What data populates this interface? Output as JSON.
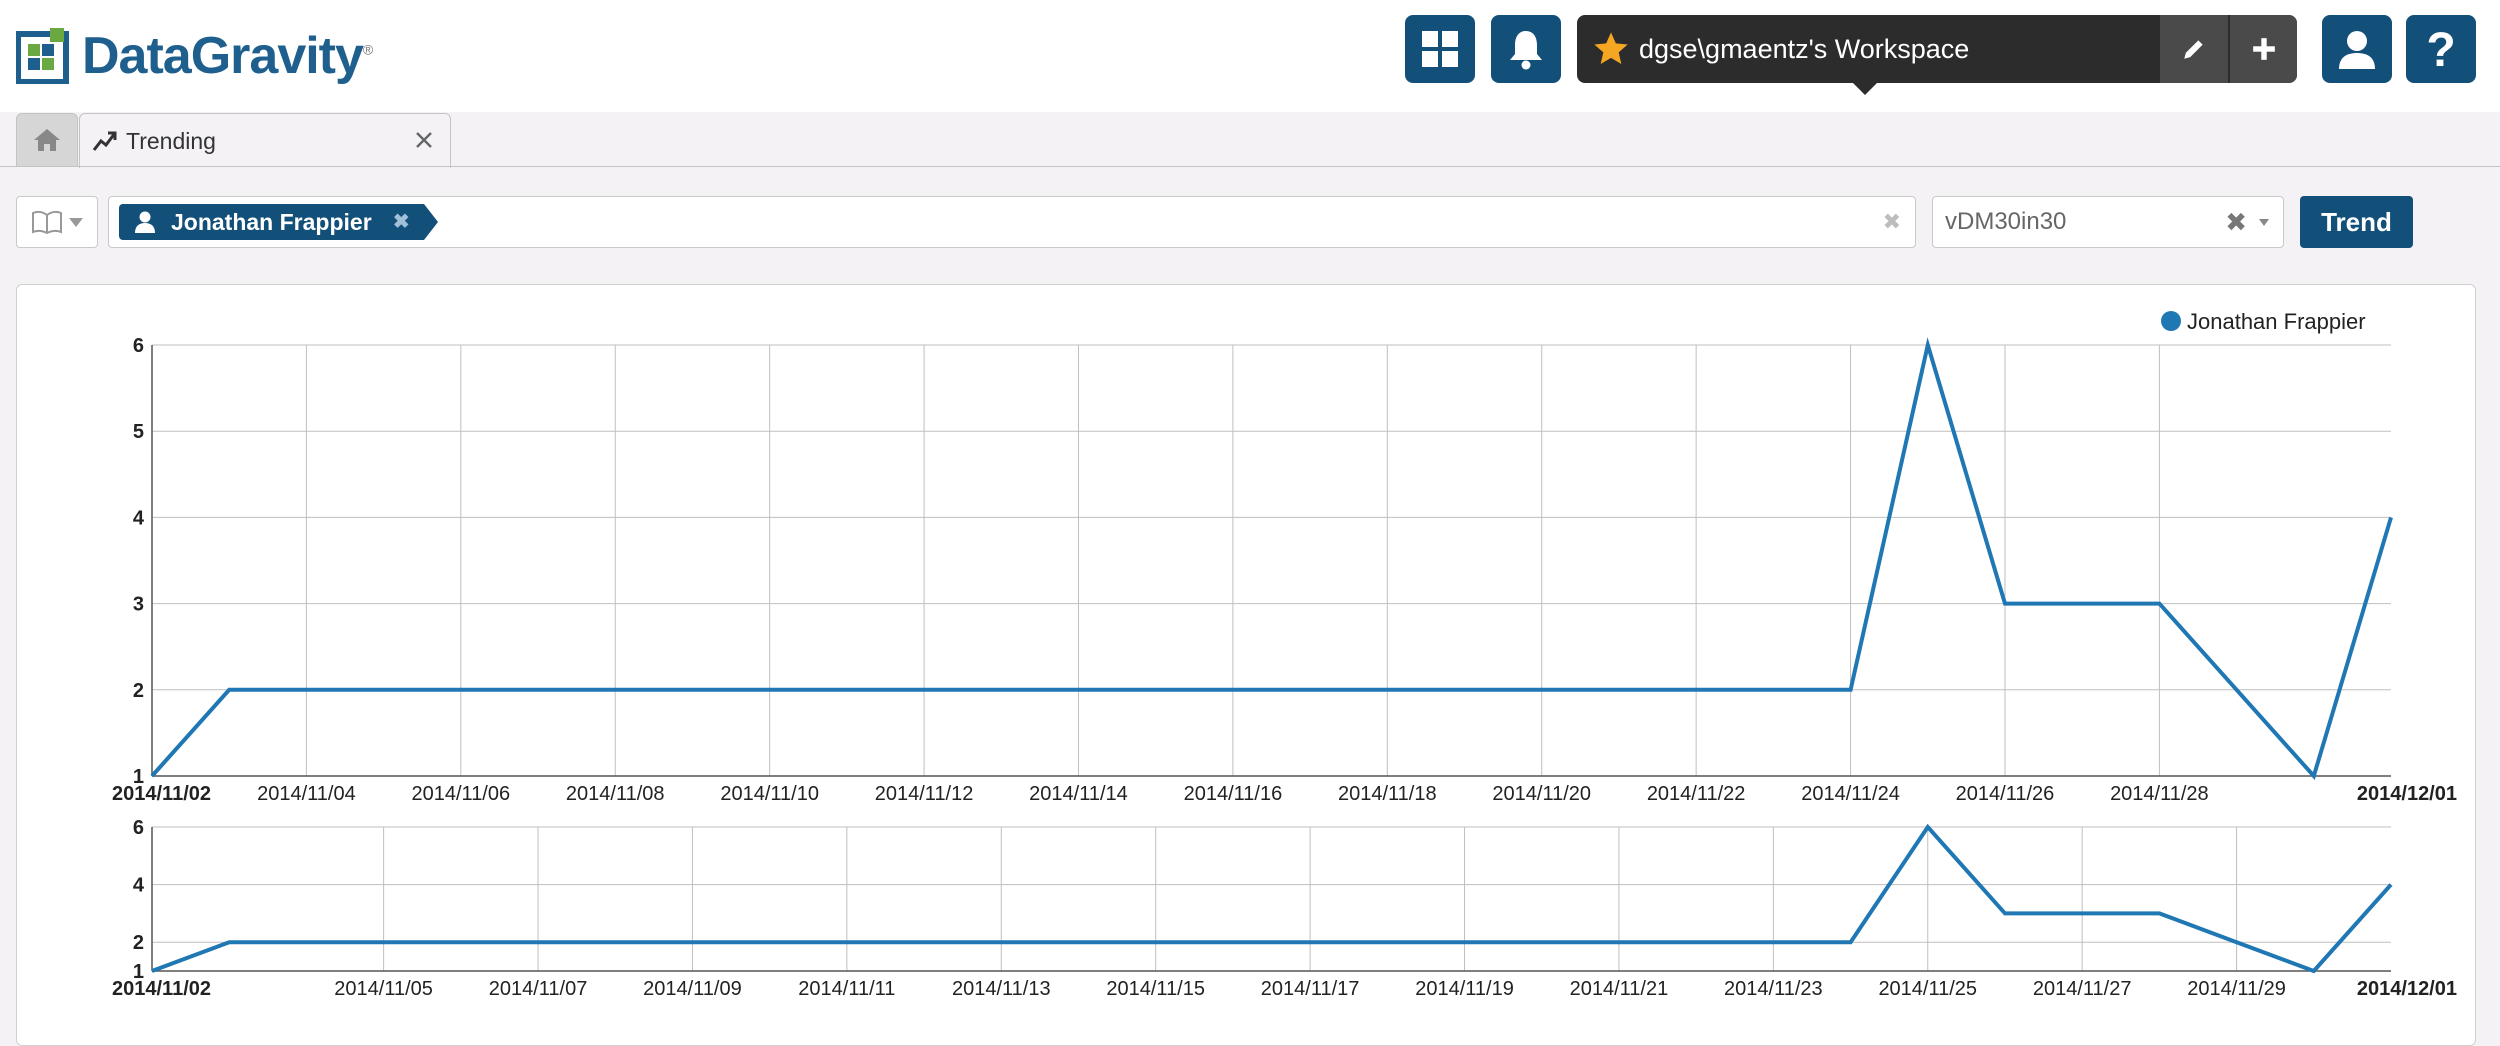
{
  "app": {
    "logo_text": "DataGravity",
    "trademark": "®"
  },
  "header": {
    "workspace_label": "dgse\\gmaentz's Workspace",
    "icons": [
      "dashboard-grid-icon",
      "bell-icon",
      "star-icon",
      "pencil-icon",
      "plus-icon",
      "user-icon",
      "help-icon"
    ]
  },
  "tabs": [
    {
      "id": "home",
      "icon": "home-icon",
      "label": ""
    },
    {
      "id": "trending",
      "icon": "trending-icon",
      "label": "Trending",
      "close": "✕"
    }
  ],
  "filter": {
    "tag_label": "Jonathan Frappier",
    "tag_remove": "✖",
    "search_clear": "✖",
    "select_value": "vDM30in30",
    "select_clear": "✖",
    "trend_button": "Trend"
  },
  "colors": {
    "brand": "#12507a",
    "line": "#1f77b4",
    "logo": "#1f5f8e"
  },
  "chart_data": [
    {
      "type": "line",
      "title": "",
      "xlabel": "",
      "ylabel": "",
      "legend": "top-right",
      "grid": true,
      "ylim": [
        1,
        6
      ],
      "yticks": [
        1,
        2,
        3,
        4,
        5,
        6
      ],
      "xlim": [
        "2014/11/02",
        "2014/12/01"
      ],
      "xticks": [
        "2014/11/02",
        "2014/11/04",
        "2014/11/06",
        "2014/11/08",
        "2014/11/10",
        "2014/11/12",
        "2014/11/14",
        "2014/11/16",
        "2014/11/18",
        "2014/11/20",
        "2014/11/22",
        "2014/11/24",
        "2014/11/26",
        "2014/11/28",
        "2014/12/01"
      ],
      "series": [
        {
          "name": "Jonathan Frappier",
          "x": [
            "2014/11/02",
            "2014/11/03",
            "2014/11/04",
            "2014/11/05",
            "2014/11/06",
            "2014/11/07",
            "2014/11/08",
            "2014/11/09",
            "2014/11/10",
            "2014/11/11",
            "2014/11/12",
            "2014/11/13",
            "2014/11/14",
            "2014/11/15",
            "2014/11/16",
            "2014/11/17",
            "2014/11/18",
            "2014/11/19",
            "2014/11/20",
            "2014/11/21",
            "2014/11/22",
            "2014/11/23",
            "2014/11/24",
            "2014/11/25",
            "2014/11/26",
            "2014/11/27",
            "2014/11/28",
            "2014/11/29",
            "2014/11/30",
            "2014/12/01"
          ],
          "y": [
            1,
            2,
            2,
            2,
            2,
            2,
            2,
            2,
            2,
            2,
            2,
            2,
            2,
            2,
            2,
            2,
            2,
            2,
            2,
            2,
            2,
            2,
            2,
            6,
            3,
            3,
            3,
            2,
            1,
            4
          ]
        }
      ]
    },
    {
      "type": "line",
      "title": "",
      "xlabel": "",
      "ylabel": "",
      "grid": true,
      "ylim": [
        1,
        6
      ],
      "yticks": [
        1,
        2,
        4,
        6
      ],
      "xlim": [
        "2014/11/02",
        "2014/12/01"
      ],
      "xticks": [
        "2014/11/02",
        "2014/11/05",
        "2014/11/07",
        "2014/11/09",
        "2014/11/11",
        "2014/11/13",
        "2014/11/15",
        "2014/11/17",
        "2014/11/19",
        "2014/11/21",
        "2014/11/23",
        "2014/11/25",
        "2014/11/27",
        "2014/11/29",
        "2014/12/01"
      ],
      "series": [
        {
          "name": "Jonathan Frappier",
          "x": [
            "2014/11/02",
            "2014/11/03",
            "2014/11/04",
            "2014/11/05",
            "2014/11/06",
            "2014/11/07",
            "2014/11/08",
            "2014/11/09",
            "2014/11/10",
            "2014/11/11",
            "2014/11/12",
            "2014/11/13",
            "2014/11/14",
            "2014/11/15",
            "2014/11/16",
            "2014/11/17",
            "2014/11/18",
            "2014/11/19",
            "2014/11/20",
            "2014/11/21",
            "2014/11/22",
            "2014/11/23",
            "2014/11/24",
            "2014/11/25",
            "2014/11/26",
            "2014/11/27",
            "2014/11/28",
            "2014/11/29",
            "2014/11/30",
            "2014/12/01"
          ],
          "y": [
            1,
            2,
            2,
            2,
            2,
            2,
            2,
            2,
            2,
            2,
            2,
            2,
            2,
            2,
            2,
            2,
            2,
            2,
            2,
            2,
            2,
            2,
            2,
            6,
            3,
            3,
            3,
            2,
            1,
            4
          ]
        }
      ]
    }
  ]
}
